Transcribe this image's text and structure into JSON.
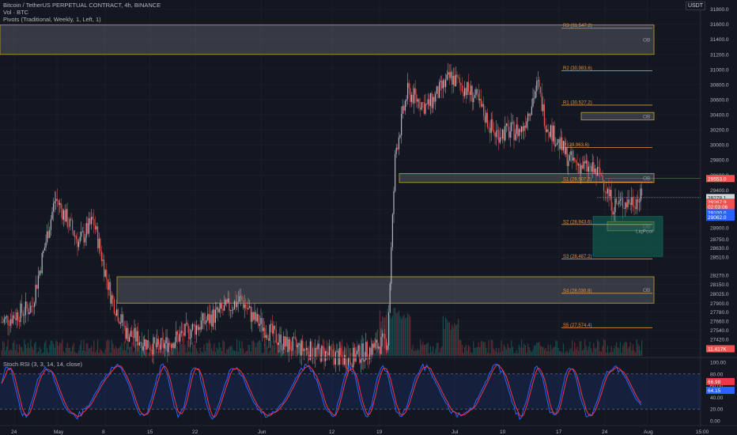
{
  "header": {
    "title": "Bitcoin / TetherUS PERPETUAL CONTRACT, 4h, BINANCE",
    "vol": "Vol · BTC",
    "pivots": "Pivots (Traditional, Weekly, 1, Left, 1)",
    "currency": "USDT"
  },
  "stoch_title": "Stoch RSI (3, 3, 14, 14, close)",
  "colors": {
    "background": "#131722",
    "up": "#b2b5be",
    "down": "#ef5350",
    "pivot": "#e69138",
    "zone": "#c9a227",
    "liq": "#0e6b5a",
    "stoch_k": "#2962ff",
    "stoch_d": "#f23645"
  },
  "chart_data": {
    "type": "candlestick",
    "symbol": "Bitcoin / TetherUS PERPETUAL CONTRACT",
    "interval": "4h",
    "exchange": "BINANCE",
    "ylim": [
      27200,
      31880
    ],
    "price_ticks": [
      31800,
      31600,
      31400,
      31200,
      31000,
      30800,
      30600,
      30400,
      30200,
      30000,
      29800,
      29600,
      29400,
      29150,
      28900,
      28750,
      28630,
      28510,
      28270,
      28150,
      28025,
      27900,
      27780,
      27660,
      27540,
      27420,
      27300
    ],
    "price_tick_labels": [
      "31800.0",
      "31600.0",
      "31400.0",
      "31200.0",
      "31000.0",
      "30800.0",
      "30600.0",
      "30400.0",
      "30200.0",
      "30000.0",
      "29800.0",
      "29600.0",
      "29400.0",
      "29150.0",
      "28900.0",
      "28750.0",
      "28630.0",
      "28510.0",
      "28270.0",
      "28150.0",
      "28025.0",
      "27900.0",
      "27780.0",
      "27660.0",
      "27540.0",
      "27420.0",
      "27300.0"
    ],
    "x_labels": [
      "24",
      "May",
      "8",
      "15",
      "22",
      "Jun",
      "12",
      "19",
      "Jul",
      "10",
      "17",
      "24",
      "Aug",
      "15:00"
    ],
    "pivots": [
      {
        "label": "R3 (31,547.2)",
        "value": 31547.2
      },
      {
        "label": "R2 (30,983.6)",
        "value": 30983.6
      },
      {
        "label": "R1 (30,527.2)",
        "value": 30527.2
      },
      {
        "label": "P (29,963.6)",
        "value": 29963.6
      },
      {
        "label": "S1 (29,507.2)",
        "value": 29507.2
      },
      {
        "label": "S2 (28,943.6)",
        "value": 28943.6
      },
      {
        "label": "S3 (28,487.2)",
        "value": 28487.2
      },
      {
        "label": "S4 (28,030.8)",
        "value": 28030.8
      },
      {
        "label": "S5 (27,574.4)",
        "value": 27574.4
      }
    ],
    "zones": [
      {
        "label": "OB",
        "top": 31590,
        "bottom": 31200
      },
      {
        "label": "OB",
        "top": 30430,
        "bottom": 30330
      },
      {
        "label": "OB",
        "top": 29620,
        "bottom": 29500
      },
      {
        "label": "OB",
        "top": 28980,
        "bottom": 28860
      },
      {
        "label": "OB",
        "top": 28250,
        "bottom": 27900
      }
    ],
    "liquidity_pool": {
      "label": "LiqPool",
      "top": 29050,
      "bottom": 28520
    },
    "price_labels": [
      {
        "text": "29553.0",
        "value": 29553,
        "color": "#ef5350"
      },
      {
        "text": "29278.1",
        "value": 29300,
        "color": "#d1d4dc"
      },
      {
        "text": "29267.9",
        "value": 29240,
        "color": "#ef5350"
      },
      {
        "text": "02:03:06",
        "value": 29180,
        "color": "#ef5350"
      },
      {
        "text": "29100.0",
        "value": 29100,
        "color": "#2962ff"
      },
      {
        "text": "29062.0",
        "value": 29040,
        "color": "#2962ff"
      },
      {
        "text": "11.417K",
        "value": 27295,
        "color": "#ef5350"
      }
    ],
    "stoch_rsi": {
      "ylim": [
        0,
        100
      ],
      "ticks": [
        100,
        80,
        60,
        40,
        20,
        0
      ],
      "tick_labels": [
        "100.00",
        "80.00",
        "60.00",
        "40.00",
        "20.00",
        "0.00"
      ],
      "k": 64.15,
      "d": 66.98,
      "k_label": "64.15",
      "d_label": "66.98",
      "upper_band": 80,
      "lower_band": 20
    }
  }
}
